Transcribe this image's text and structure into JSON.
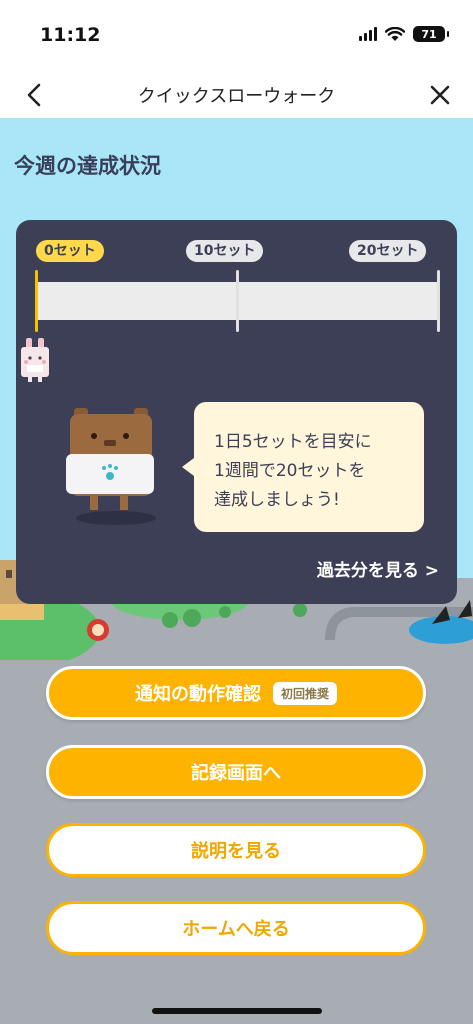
{
  "status_bar": {
    "time": "11:12",
    "battery": "71"
  },
  "nav": {
    "title": "クイックスローウォーク",
    "back_icon": "chevron-left-icon",
    "close_icon": "close-icon"
  },
  "section_title": "今週の達成状況",
  "progress": {
    "milestones": [
      "0セット",
      "10セット",
      "20セット"
    ],
    "current_sets": 0,
    "goal_sets": 20,
    "accent": "#ffd94a",
    "message_lines": [
      "1日5セットを目安に",
      "1週間で20セットを",
      "達成しましょう!"
    ],
    "past_link": "過去分を見る >"
  },
  "buttons": {
    "notification": "通知の動作確認",
    "notification_badge": "初回推奨",
    "record": "記録画面へ",
    "explain": "説明を見る",
    "home": "ホームへ戻る"
  },
  "colors": {
    "card": "#3d3f57",
    "button_primary": "#fdb300",
    "sky": "#a9e6f7"
  }
}
